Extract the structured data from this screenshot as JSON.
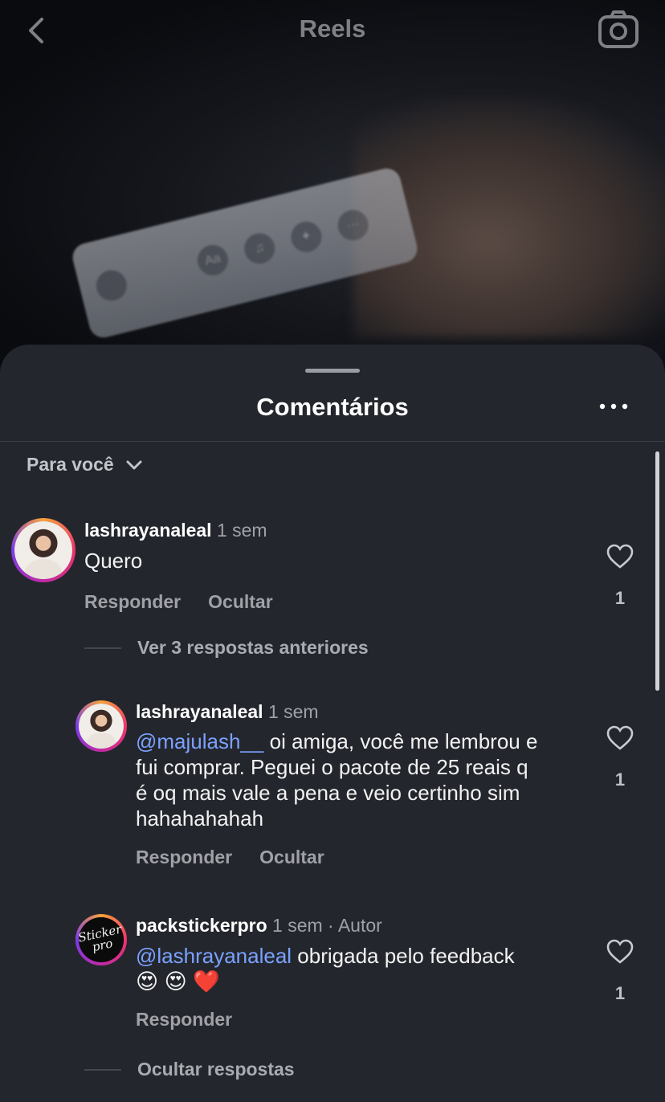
{
  "header": {
    "title": "Reels"
  },
  "sheet": {
    "title": "Comentários",
    "filter_label": "Para você"
  },
  "video_strip": [
    "Aa",
    "♫",
    "✦",
    "···"
  ],
  "comments": [
    {
      "username": "lashrayanaleal",
      "time": "1 sem",
      "text": "Quero",
      "actions": [
        "Responder",
        "Ocultar"
      ],
      "likes": "1"
    }
  ],
  "view_previous": "Ver 3 respostas anteriores",
  "replies": [
    {
      "username": "lashrayanaleal",
      "time": "1 sem",
      "mention": "@majulash__",
      "text": "oi amiga, você me lembrou e",
      "text_lines": [
        "fui comprar. Peguei o pacote de 25 reais q",
        "é oq mais vale a pena e veio certinho sim",
        "hahahahahah"
      ],
      "actions": [
        "Responder",
        "Ocultar"
      ],
      "likes": "1"
    },
    {
      "username": "packstickerpro",
      "time": "1 sem · Autor",
      "avatar_text": "Sticker pro",
      "mention": "@lashrayanaleal",
      "text": "obrigada pelo feedback",
      "emojis": "😍 😍 ❤️",
      "actions": [
        "Responder"
      ],
      "likes": "1"
    }
  ],
  "hide_replies": "Ocultar respostas"
}
